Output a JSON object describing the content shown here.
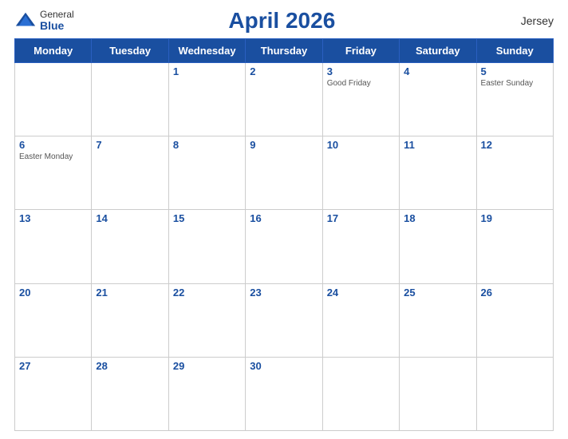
{
  "header": {
    "title": "April 2026",
    "region": "Jersey",
    "logo": {
      "general": "General",
      "blue": "Blue"
    }
  },
  "calendar": {
    "days_of_week": [
      "Monday",
      "Tuesday",
      "Wednesday",
      "Thursday",
      "Friday",
      "Saturday",
      "Sunday"
    ],
    "weeks": [
      [
        {
          "day": "",
          "holiday": ""
        },
        {
          "day": "",
          "holiday": ""
        },
        {
          "day": "1",
          "holiday": ""
        },
        {
          "day": "2",
          "holiday": ""
        },
        {
          "day": "3",
          "holiday": "Good Friday"
        },
        {
          "day": "4",
          "holiday": ""
        },
        {
          "day": "5",
          "holiday": "Easter Sunday"
        }
      ],
      [
        {
          "day": "6",
          "holiday": "Easter Monday"
        },
        {
          "day": "7",
          "holiday": ""
        },
        {
          "day": "8",
          "holiday": ""
        },
        {
          "day": "9",
          "holiday": ""
        },
        {
          "day": "10",
          "holiday": ""
        },
        {
          "day": "11",
          "holiday": ""
        },
        {
          "day": "12",
          "holiday": ""
        }
      ],
      [
        {
          "day": "13",
          "holiday": ""
        },
        {
          "day": "14",
          "holiday": ""
        },
        {
          "day": "15",
          "holiday": ""
        },
        {
          "day": "16",
          "holiday": ""
        },
        {
          "day": "17",
          "holiday": ""
        },
        {
          "day": "18",
          "holiday": ""
        },
        {
          "day": "19",
          "holiday": ""
        }
      ],
      [
        {
          "day": "20",
          "holiday": ""
        },
        {
          "day": "21",
          "holiday": ""
        },
        {
          "day": "22",
          "holiday": ""
        },
        {
          "day": "23",
          "holiday": ""
        },
        {
          "day": "24",
          "holiday": ""
        },
        {
          "day": "25",
          "holiday": ""
        },
        {
          "day": "26",
          "holiday": ""
        }
      ],
      [
        {
          "day": "27",
          "holiday": ""
        },
        {
          "day": "28",
          "holiday": ""
        },
        {
          "day": "29",
          "holiday": ""
        },
        {
          "day": "30",
          "holiday": ""
        },
        {
          "day": "",
          "holiday": ""
        },
        {
          "day": "",
          "holiday": ""
        },
        {
          "day": "",
          "holiday": ""
        }
      ]
    ]
  }
}
